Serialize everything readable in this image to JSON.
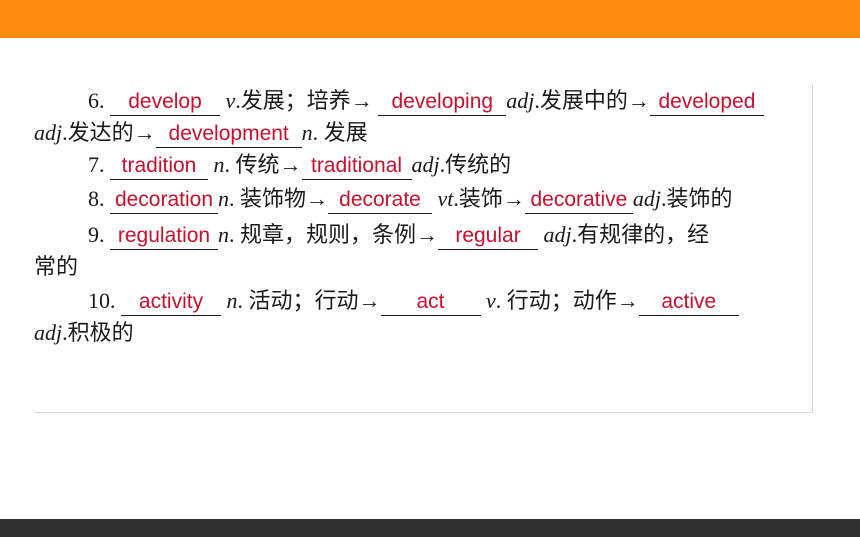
{
  "colors": {
    "top_bar": "#ff8c0f",
    "bottom_bar": "#2f2f2f",
    "answer": "#c8102e"
  },
  "items": [
    {
      "num": "6.",
      "ans1": "develop",
      "pos1": "v",
      "t1": ".发展；培养→",
      "ans2": "developing",
      "pos2": "adj",
      "t2": ".发展中的→",
      "ans3": "developed",
      "pos3": "adj",
      "t3": ".发达的→",
      "ans4": "development",
      "pos4": "n",
      "t4": ". 发展"
    },
    {
      "num": "7.",
      "ans1": "tradition",
      "pos1": "n",
      "t1": ". 传统→",
      "ans2": "traditional",
      "pos2": "adj",
      "t2": ".传统的"
    },
    {
      "num": "8.",
      "ans1": "decoration",
      "pos1": "n",
      "t1": ". 装饰物→",
      "ans2": "decorate",
      "pos2": "vt",
      "t2": ".装饰→",
      "ans3": "decorative",
      "pos3": "adj",
      "t3": ".装饰的"
    },
    {
      "num": "9.",
      "ans1": "regulation",
      "pos1": "n",
      "t1": ". 规章，规则，条例→",
      "ans2": "regular",
      "pos2": "adj",
      "t2": ".有规律的，经",
      "t2b": "常的"
    },
    {
      "num": "10.",
      "ans1": "activity",
      "pos1": "n",
      "t1": ". 活动；行动→",
      "ans2": "act",
      "pos2": "v",
      "t2": ". 行动；动作→",
      "ans3": "active",
      "pos3": "adj",
      "t3": ".积极的"
    }
  ]
}
